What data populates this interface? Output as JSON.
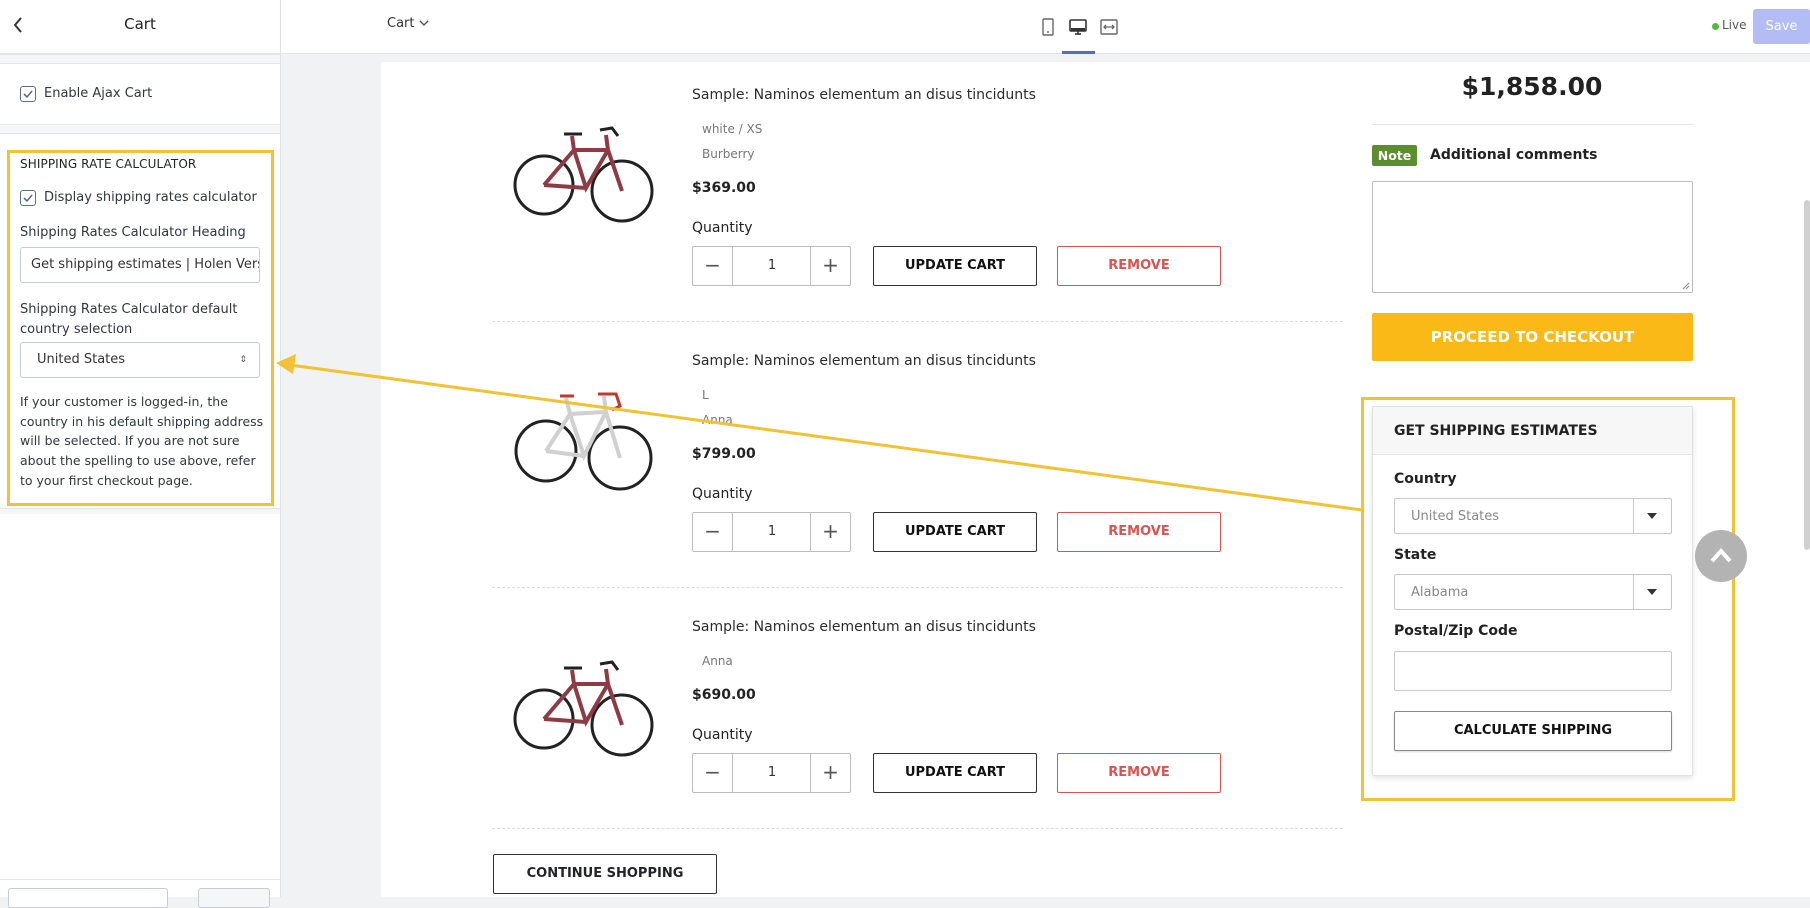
{
  "sidebar": {
    "title": "Cart",
    "enable_ajax_label": "Enable Ajax Cart",
    "section_title": "SHIPPING RATE CALCULATOR",
    "display_calc_label": "Display shipping rates calculator",
    "heading_label": "Shipping Rates Calculator Heading",
    "heading_value": "Get shipping estimates | Holen Versandkostenschätzungen",
    "country_label": "Shipping Rates Calculator default country selection",
    "country_value": "United States",
    "help_text": "If your customer is logged-in, the country in his default shipping address will be selected. If you are not sure about the spelling to use above, refer to your first checkout page."
  },
  "topbar": {
    "page_select": "Cart",
    "live_label": "Live",
    "save_label": "Save"
  },
  "cart": {
    "quantity_label": "Quantity",
    "update_label": "UPDATE CART",
    "remove_label": "REMOVE",
    "items": [
      {
        "title": "Sample: Naminos elementum an disus tincidunts",
        "variants": [
          "white / XS",
          "Burberry"
        ],
        "price": "$369.00",
        "qty": "1"
      },
      {
        "title": "Sample: Naminos elementum an disus tincidunts",
        "variants": [
          "L",
          "Anna"
        ],
        "price": "$799.00",
        "qty": "1"
      },
      {
        "title": "Sample: Naminos elementum an disus tincidunts",
        "variants": [
          "Anna"
        ],
        "price": "$690.00",
        "qty": "1"
      }
    ],
    "continue_label": "CONTINUE SHOPPING",
    "total": "$1,858.00",
    "note_badge": "Note",
    "note_label": "Additional comments",
    "checkout_label": "PROCEED TO CHECKOUT"
  },
  "shipping": {
    "title": "GET SHIPPING ESTIMATES",
    "country_label": "Country",
    "country_value": "United States",
    "state_label": "State",
    "state_value": "Alabama",
    "zip_label": "Postal/Zip Code",
    "calc_label": "CALCULATE SHIPPING"
  },
  "colors": {
    "highlight": "#f1c232",
    "checkout": "#fbb917",
    "note_badge": "#5c8d2e",
    "remove": "#d9534f",
    "save": "#b3bcf5"
  }
}
